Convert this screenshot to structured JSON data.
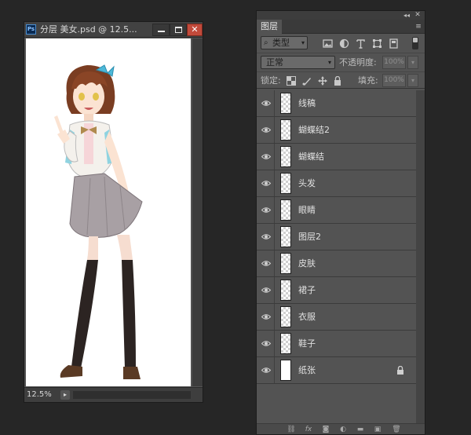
{
  "document": {
    "app_badge": "Ps",
    "title": "分层 美女.psd @ 12.5...",
    "zoom": "12.5%"
  },
  "window_controls": {
    "close_glyph": "✕"
  },
  "layers_panel": {
    "tab_label": "图层",
    "filter": {
      "kind_label": "类型"
    },
    "blend_mode": "正常",
    "opacity_label": "不透明度:",
    "opacity_value": "100%",
    "lock_label": "锁定:",
    "fill_label": "填充:",
    "fill_value": "100%",
    "layers": [
      {
        "name": "线稿",
        "visible": true,
        "thumb": "transparent",
        "locked": false
      },
      {
        "name": "蝴蝶结2",
        "visible": true,
        "thumb": "transparent",
        "locked": false
      },
      {
        "name": "蝴蝶结",
        "visible": true,
        "thumb": "transparent",
        "locked": false
      },
      {
        "name": "头发",
        "visible": true,
        "thumb": "transparent",
        "locked": false
      },
      {
        "name": "眼睛",
        "visible": true,
        "thumb": "transparent",
        "locked": false
      },
      {
        "name": "图层2",
        "visible": true,
        "thumb": "transparent",
        "locked": false
      },
      {
        "name": "皮肤",
        "visible": true,
        "thumb": "transparent",
        "locked": false
      },
      {
        "name": "裙子",
        "visible": true,
        "thumb": "transparent",
        "locked": false
      },
      {
        "name": "衣服",
        "visible": true,
        "thumb": "transparent",
        "locked": false
      },
      {
        "name": "鞋子",
        "visible": true,
        "thumb": "transparent",
        "locked": false
      },
      {
        "name": "纸张",
        "visible": true,
        "thumb": "white",
        "locked": true
      }
    ],
    "bottom_icons": [
      "link-layers-icon",
      "fx-icon",
      "layer-mask-icon",
      "adjustment-layer-icon",
      "new-group-icon",
      "new-layer-icon",
      "delete-layer-icon"
    ]
  },
  "colors": {
    "app_background": "#262626",
    "panel_background": "#535353",
    "close_button": "#c24a3b"
  }
}
